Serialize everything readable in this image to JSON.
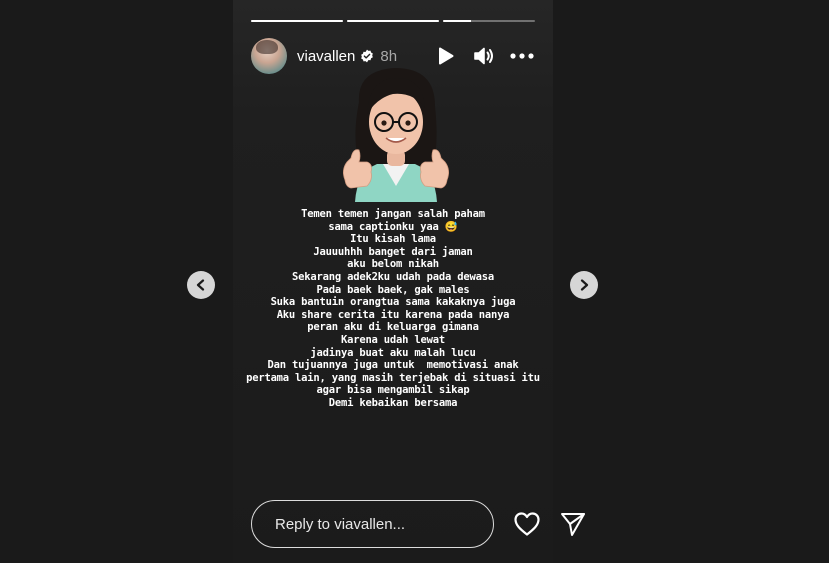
{
  "story": {
    "progress": [
      1.0,
      1.0,
      0.3
    ],
    "username": "viavallen",
    "verified": true,
    "time": "8h",
    "icons": {
      "play": "play-icon",
      "sound": "volume-icon",
      "more": "more-horizontal-icon",
      "verified": "verified-badge-icon"
    },
    "caption_lines": [
      "Temen temen jangan salah paham",
      "sama captionku yaa 😅",
      "Itu kisah lama",
      "Jauuuhhh banget dari jaman",
      "aku belom nikah",
      "Sekarang adek2ku udah pada dewasa",
      "Pada baek baek, gak males",
      "Suka bantuin orangtua sama kakaknya juga",
      "Aku share cerita itu karena pada nanya",
      "peran aku di keluarga gimana",
      "Karena udah lewat",
      "jadinya buat aku malah lucu",
      "Dan tujuannya juga untuk  memotivasi anak",
      "pertama lain, yang masih terjebak di situasi itu",
      "agar bisa mengambil sikap",
      "Demi kebaikan bersama"
    ]
  },
  "navigation": {
    "prev_icon": "chevron-left-icon",
    "next_icon": "chevron-right-icon"
  },
  "footer": {
    "reply_placeholder": "Reply to viavallen...",
    "like_icon": "heart-icon",
    "share_icon": "send-icon"
  },
  "colors": {
    "page_bg": "#1a1a1a",
    "story_bg": "#1f1f1f",
    "text": "#ffffff",
    "muted": "#a8a8a8",
    "verified": "#ffffff",
    "nav_button": "#d6d6d6"
  }
}
